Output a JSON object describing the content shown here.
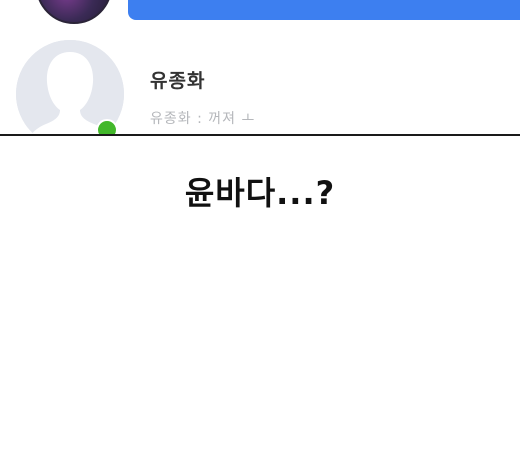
{
  "contact": {
    "name": "유종화",
    "preview": "유종화 : 꺼져 ㅗ"
  },
  "caption": "윤바다...?",
  "colors": {
    "bubble": "#3d7ff0",
    "online_status": "#42b72a"
  },
  "icons": {
    "avatar": "default-profile-silhouette-icon",
    "status": "online-dot-icon"
  }
}
